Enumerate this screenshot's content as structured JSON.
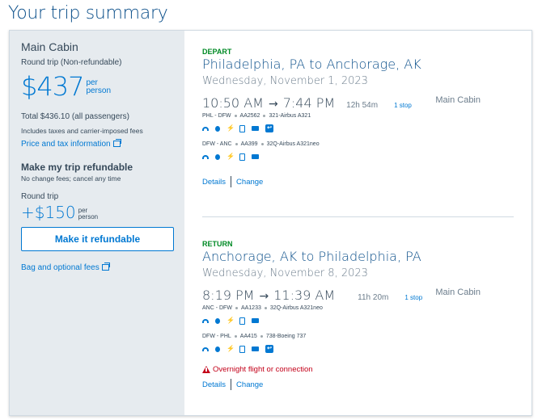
{
  "page_title": "Your trip summary",
  "sidebar": {
    "cabin": "Main Cabin",
    "trip_type": "Round trip (Non-refundable)",
    "price": "$437",
    "per": "per",
    "person": "person",
    "total": "Total $436.10 (all passengers)",
    "taxes_note": "Includes taxes and carrier-imposed fees",
    "price_tax_link": "Price and tax information",
    "refund_heading": "Make my trip refundable",
    "refund_sub": "No change fees; cancel any time",
    "round_trip": "Round trip",
    "refund_price": "+$150",
    "refund_per": "per",
    "refund_person": "person",
    "refund_button": "Make it refundable",
    "bag_link": "Bag and optional fees"
  },
  "depart": {
    "label": "DEPART",
    "route": "Philadelphia, PA to Anchorage, AK",
    "date": "Wednesday, November 1, 2023",
    "dep_time": "10:50 AM",
    "arrow": "→",
    "arr_time": "7:44 PM",
    "duration": "12h 54m",
    "stops": "1 stop",
    "cabin": "Main Cabin",
    "seg1": {
      "route": "PHL - DFW",
      "flight": "AA2562",
      "aircraft": "321-Airbus A321"
    },
    "seg2": {
      "route": "DFW - ANC",
      "flight": "AA399",
      "aircraft": "32Q-Airbus A321neo"
    },
    "details": "Details",
    "change": "Change"
  },
  "return": {
    "label": "RETURN",
    "route": "Anchorage, AK to Philadelphia, PA",
    "date": "Wednesday, November 8, 2023",
    "dep_time": "8:19 PM",
    "arrow": "→",
    "arr_time": "11:39 AM",
    "duration": "11h 20m",
    "stops": "1 stop",
    "cabin": "Main Cabin",
    "seg1": {
      "route": "ANC - DFW",
      "flight": "AA1233",
      "aircraft": "32Q-Airbus A321neo"
    },
    "seg2": {
      "route": "DFW - PHL",
      "flight": "AA415",
      "aircraft": "738-Boeing 737"
    },
    "warning": "Overnight flight or connection",
    "details": "Details",
    "change": "Change"
  },
  "amenity_icons": [
    "wifi-icon",
    "entertainment-icon",
    "power-outlet-icon",
    "phone-icon",
    "tv-icon",
    "app-icon"
  ],
  "colors": {
    "accent": "#0078d2",
    "title": "#0b4f8a",
    "depart_label": "#008a25",
    "warning": "#c30019",
    "sidebar_bg": "#e6ebef"
  }
}
